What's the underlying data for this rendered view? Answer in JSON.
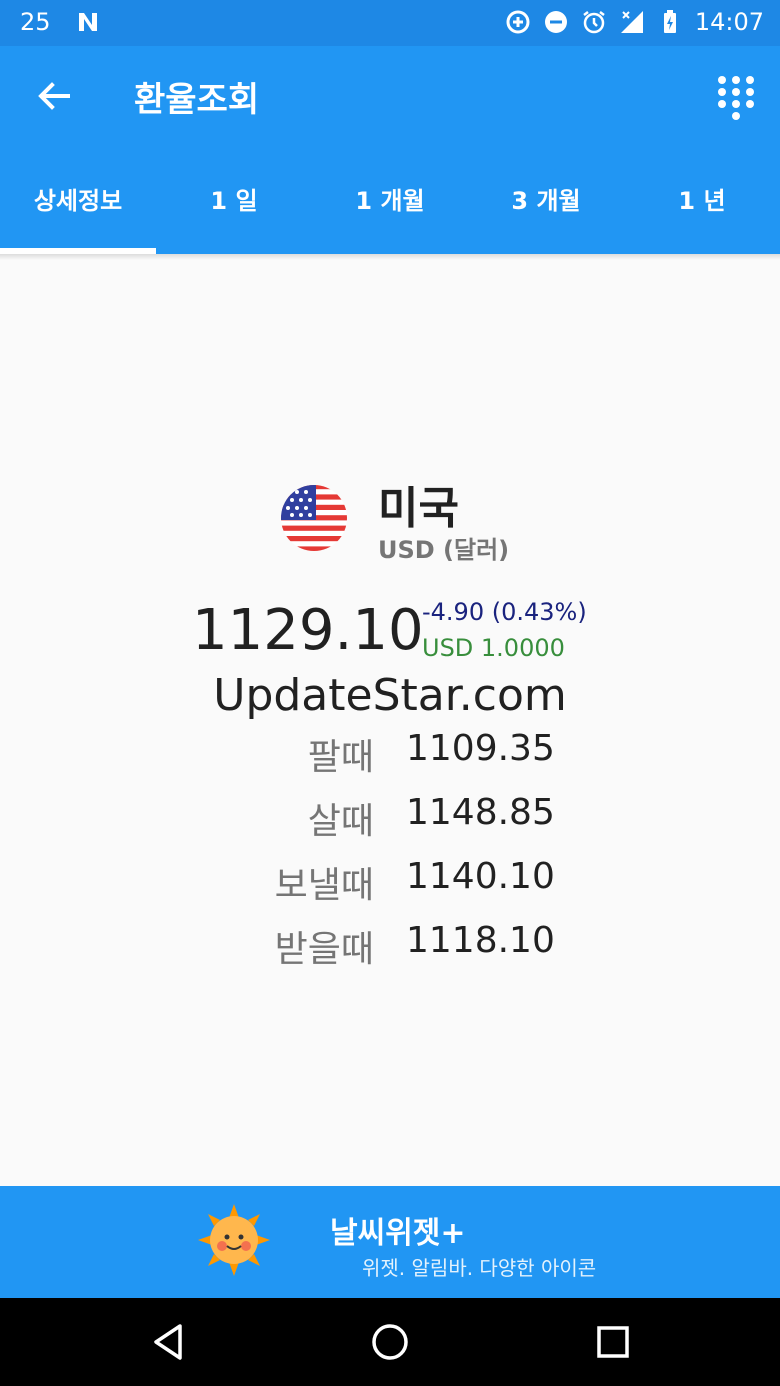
{
  "status_bar": {
    "left_number": "25",
    "time": "14:07",
    "icons": [
      "n-icon",
      "data-saver-icon",
      "dnd-icon",
      "alarm-icon",
      "signal-off-icon",
      "battery-charging-icon"
    ]
  },
  "app_bar": {
    "title": "환율조회",
    "back_icon": "back-arrow-icon",
    "menu_icon": "dialpad-icon"
  },
  "tabs": [
    {
      "label": "상세정보",
      "active": true
    },
    {
      "label": "1 일",
      "active": false
    },
    {
      "label": "1 개월",
      "active": false
    },
    {
      "label": "3 개월",
      "active": false
    },
    {
      "label": "1 년",
      "active": false
    }
  ],
  "currency": {
    "country": "미국",
    "code_label": "USD (달러)",
    "flag_icon": "us-flag-icon",
    "rate": "1129.10",
    "change": "-4.90 (0.43%)",
    "base": "USD 1.0000"
  },
  "watermark": "UpdateStar.com",
  "rates": [
    {
      "label": "팔때",
      "value": "1109.35"
    },
    {
      "label": "살때",
      "value": "1148.85"
    },
    {
      "label": "보낼때",
      "value": "1140.10"
    },
    {
      "label": "받을때",
      "value": "1118.10"
    }
  ],
  "ad": {
    "title": "날씨위젯+",
    "subtitle": "위젯. 알림바. 다양한 아이콘",
    "icon": "sun-icon"
  },
  "nav": {
    "back": "nav-back-icon",
    "home": "nav-home-icon",
    "recents": "nav-recents-icon"
  },
  "colors": {
    "primary": "#2196f3",
    "status_bar": "#1e88e5",
    "change_text": "#1a237e",
    "base_text": "#388e3c"
  }
}
